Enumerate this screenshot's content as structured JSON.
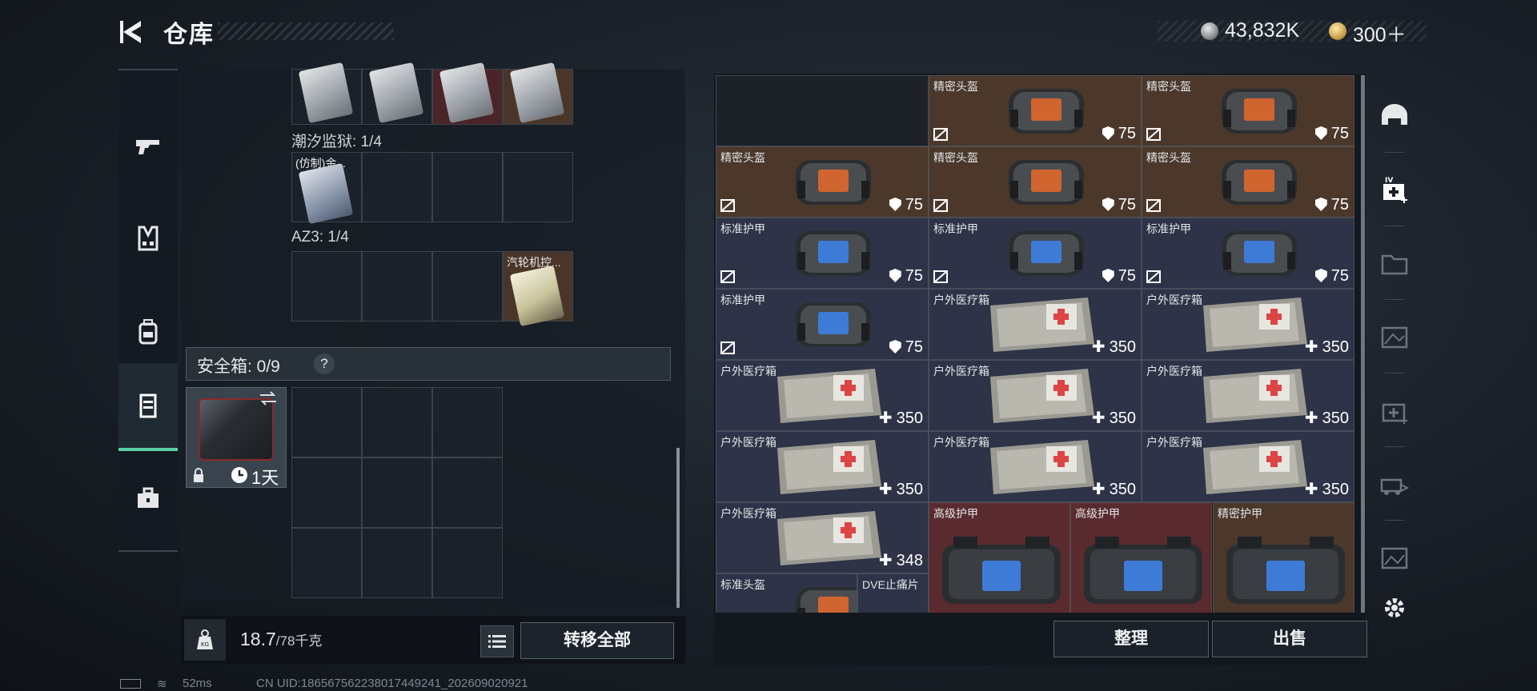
{
  "header": {
    "title": "仓库",
    "currency_silver": "43,832K",
    "currency_gold": "300＋"
  },
  "rail": {
    "items": [
      {
        "icon": "gun-icon"
      },
      {
        "icon": "vest-icon"
      },
      {
        "icon": "backpack-icon"
      },
      {
        "icon": "container-icon",
        "active": true
      },
      {
        "icon": "toolbox-icon"
      }
    ]
  },
  "left": {
    "row1_label": "潮汐监狱: 1/4",
    "row1_item_name": "(仿制)金...",
    "row2_label": "AZ3: 1/4",
    "row2_item_name": "汽轮机控...",
    "safe_label": "安全箱: 0/9",
    "safe_help": "?",
    "safe_timer": "1天",
    "weight_value": "18.7",
    "weight_max": "/78千克",
    "transfer_all": "转移全部"
  },
  "stash": {
    "cells": [
      {
        "name": "",
        "stat": "",
        "type": "empty"
      },
      {
        "name": "精密头盔",
        "stat": "75",
        "type": "helmet-red"
      },
      {
        "name": "精密头盔",
        "stat": "75",
        "type": "helmet-red"
      },
      {
        "name": "精密头盔",
        "stat": "75",
        "type": "helmet-red"
      },
      {
        "name": "精密头盔",
        "stat": "75",
        "type": "helmet-red"
      },
      {
        "name": "精密头盔",
        "stat": "75",
        "type": "helmet-red"
      },
      {
        "name": "标准护甲",
        "stat": "75",
        "type": "helmet-blue"
      },
      {
        "name": "标准护甲",
        "stat": "75",
        "type": "helmet-blue"
      },
      {
        "name": "标准护甲",
        "stat": "75",
        "type": "helmet-blue"
      },
      {
        "name": "标准护甲",
        "stat": "75",
        "type": "helmet-blue"
      },
      {
        "name": "户外医疗箱",
        "stat": "350",
        "type": "medkit"
      },
      {
        "name": "户外医疗箱",
        "stat": "350",
        "type": "medkit"
      },
      {
        "name": "户外医疗箱",
        "stat": "350",
        "type": "medkit"
      },
      {
        "name": "户外医疗箱",
        "stat": "350",
        "type": "medkit"
      },
      {
        "name": "户外医疗箱",
        "stat": "350",
        "type": "medkit"
      },
      {
        "name": "户外医疗箱",
        "stat": "350",
        "type": "medkit"
      },
      {
        "name": "户外医疗箱",
        "stat": "350",
        "type": "medkit"
      },
      {
        "name": "户外医疗箱",
        "stat": "350",
        "type": "medkit"
      },
      {
        "name": "户外医疗箱",
        "stat": "348",
        "type": "medkit"
      },
      {
        "name": "高级护甲",
        "stat": "",
        "type": "armor-big"
      },
      {
        "name": "高级护甲",
        "stat": "",
        "type": "armor-big"
      },
      {
        "name": "精密护甲",
        "stat": "",
        "type": "armor-big-dark"
      },
      {
        "name": "标准头盔",
        "stat": "",
        "type": "helmet-partial"
      },
      {
        "name": "DVE止痛片",
        "stat": "",
        "type": "pills-partial"
      }
    ],
    "sort": "整理",
    "sell": "出售"
  },
  "right_rail": {
    "items": [
      {
        "icon": "helmet-icon"
      },
      {
        "icon": "medkit-lv4-icon"
      },
      {
        "icon": "folder-icon"
      },
      {
        "icon": "map-icon"
      },
      {
        "icon": "medkit-icon"
      },
      {
        "icon": "vehicle-icon"
      },
      {
        "icon": "image-icon"
      },
      {
        "icon": "settings-icon"
      }
    ]
  },
  "footer": {
    "ping": "52ms",
    "uid": "CN UID:1865675622380174492​41_202609020921"
  },
  "colors": {
    "accent_green": "#59d1a6",
    "cell_brown": "#4b382b",
    "cell_blue": "#2e3347",
    "cell_maroon": "#5a2b2e"
  }
}
